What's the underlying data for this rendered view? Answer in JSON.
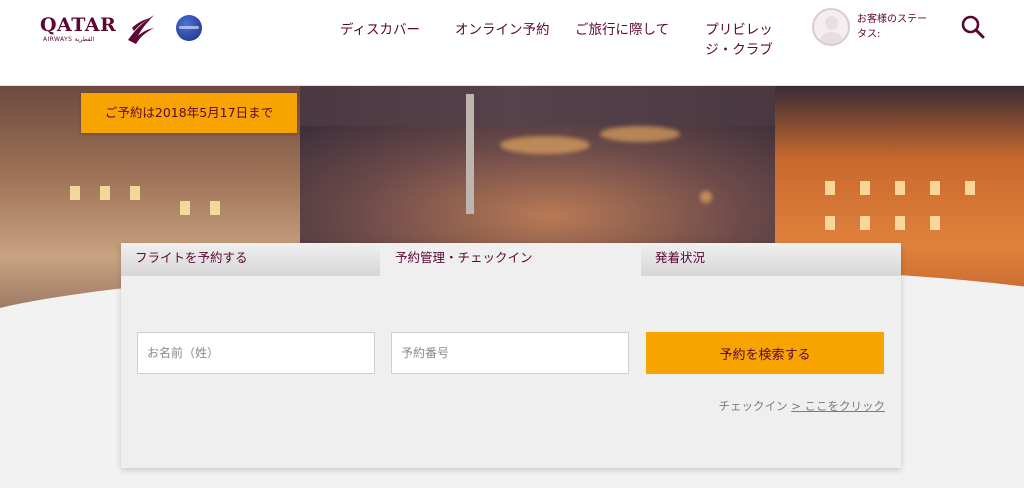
{
  "header": {
    "logo_text": "QATAR",
    "logo_sub": "AIRWAYS القطرية",
    "nav": [
      {
        "label": "ディスカバー"
      },
      {
        "label": "オンライン予約"
      },
      {
        "label": "ご旅行に際して"
      },
      {
        "label": "プリビレッジ・クラブ"
      }
    ],
    "status_text": "お客様のステータス:",
    "search_icon": "search-icon"
  },
  "hero": {
    "promo_label": "ご予約は2018年5月17日まで"
  },
  "booking": {
    "tabs": [
      {
        "label": "フライトを予約する",
        "active": false
      },
      {
        "label": "予約管理・チェックイン",
        "active": true
      },
      {
        "label": "発着状況",
        "active": false
      }
    ],
    "last_name_placeholder": "お名前（姓）",
    "booking_ref_placeholder": "予約番号",
    "submit_label": "予約を検索する",
    "checkin_text": "チェックイン",
    "checkin_link": "> ここをクリック"
  },
  "colors": {
    "brand": "#5c0632",
    "accent": "#f7a400",
    "card_bg": "#efefef"
  }
}
